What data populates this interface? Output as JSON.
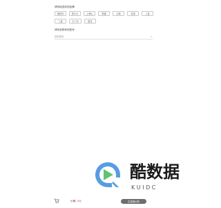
{
  "brand_section": {
    "label": "请你挑选你的品牌:",
    "brands": [
      [
        "微软你",
        "那大大",
        "上海比",
        "希捷",
        "长城",
        "富康",
        "三星"
      ],
      [
        "三星",
        "五十铃",
        "雷克"
      ]
    ]
  },
  "model_section": {
    "label": "请你选择你的型号:",
    "select_placeholder": "您的型号"
  },
  "watermark": {
    "text": "酷数据",
    "sub": "K U I D C"
  },
  "footer": {
    "price_prefix": "价格:",
    "price_value": "0元",
    "submit_label": "生成报价单"
  },
  "colors": {
    "price": "#e23b3b",
    "logo_blue": "#3a8be0",
    "logo_green": "#62c276"
  }
}
